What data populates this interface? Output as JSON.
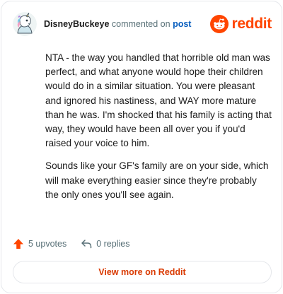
{
  "comment": {
    "username": "DisneyBuckeye",
    "commented_text": "commented on",
    "post_link": "post",
    "avatar_icon": "unicorn-avatar-icon",
    "paragraphs": [
      "NTA - the way you handled that horrible old man was perfect, and what anyone would hope their children would do in a similar situation. You were pleasant and ignored his nastiness, and WAY more mature than he was. I'm shocked that his family is acting that way, they would have been all over you if you'd raised your voice to him.",
      "Sounds like your GF's family are on your side, which will make everything easier since they're probably the only ones you'll see again."
    ]
  },
  "brand": {
    "logo_text": "reddit",
    "logo_icon": "reddit-snoo-icon",
    "color": "#ff4500"
  },
  "actions": {
    "upvotes": "5 upvotes",
    "upvote_icon": "upvote-arrow-icon",
    "upvote_color": "#ff4500",
    "replies": "0 replies",
    "reply_icon": "reply-arrow-icon"
  },
  "footer": {
    "view_more_label": "View more on Reddit",
    "accent": "#d93900"
  }
}
